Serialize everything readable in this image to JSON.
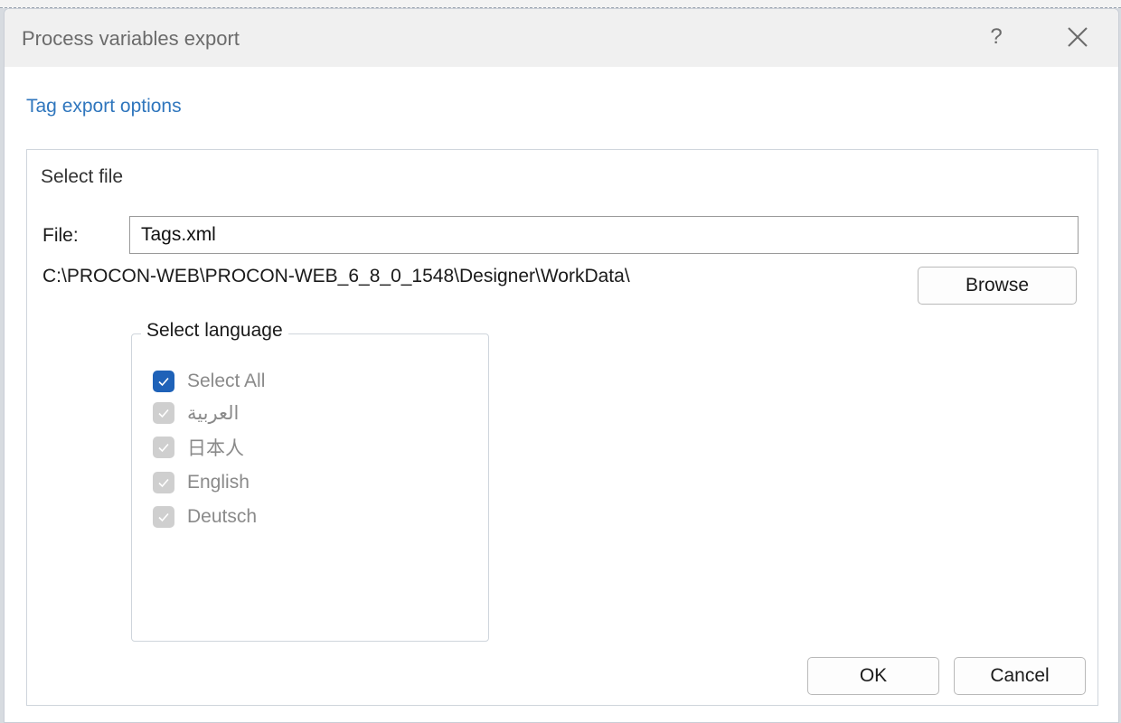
{
  "window": {
    "title": "Process variables export",
    "help_label": "?"
  },
  "section_link": "Tag export options",
  "group": {
    "title": "Select file",
    "file_label": "File:",
    "file_value": "Tags.xml",
    "path": "C:\\PROCON-WEB\\PROCON-WEB_6_8_0_1548\\Designer\\WorkData\\",
    "browse_label": "Browse"
  },
  "languages": {
    "title": "Select language",
    "items": [
      {
        "label": "Select All",
        "checked": true,
        "enabled": true
      },
      {
        "label": "العربية",
        "checked": true,
        "enabled": false
      },
      {
        "label": "日本人",
        "checked": true,
        "enabled": false
      },
      {
        "label": "English",
        "checked": true,
        "enabled": false
      },
      {
        "label": "Deutsch",
        "checked": true,
        "enabled": false
      }
    ]
  },
  "buttons": {
    "ok_label": "OK",
    "cancel_label": "Cancel"
  },
  "colors": {
    "accent": "#1f62b8",
    "link": "#2f76bd",
    "disabled_checkbox": "#cfcfcf"
  }
}
